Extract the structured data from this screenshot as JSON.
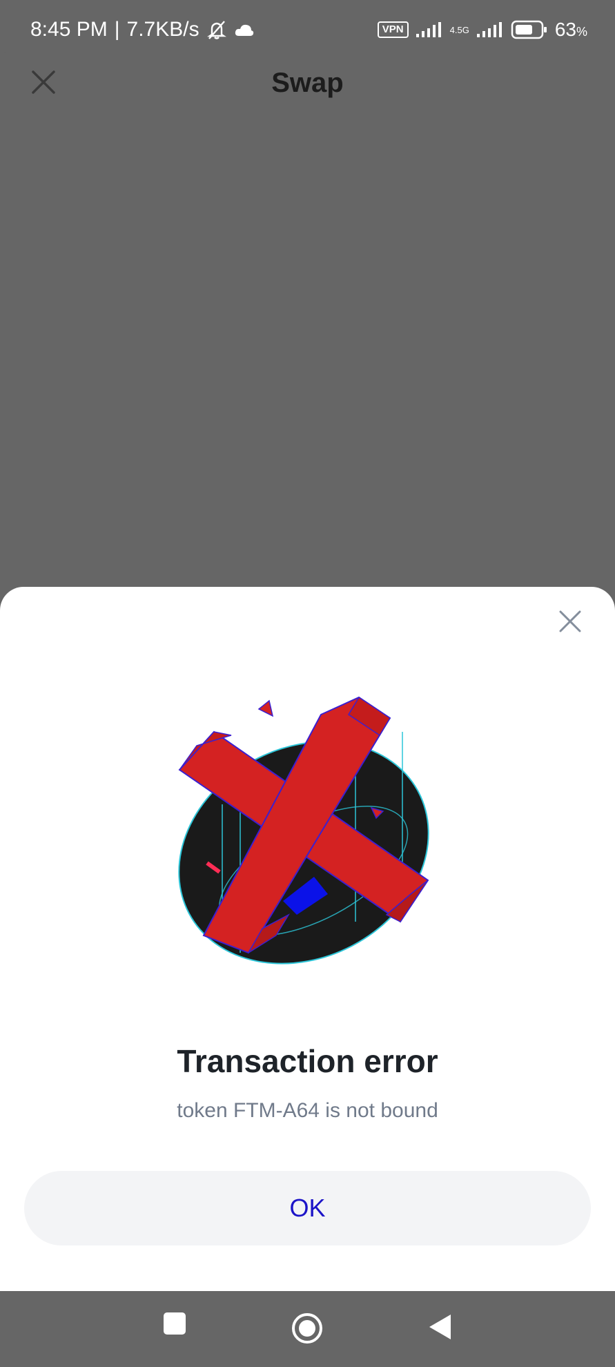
{
  "status_bar": {
    "time": "8:45 PM",
    "separator": "|",
    "network_speed": "7.7KB/s",
    "vpn_label": "VPN",
    "network_type": "4.5G",
    "battery_level": "63",
    "battery_unit": "%"
  },
  "app": {
    "title": "Swap"
  },
  "dialog": {
    "title": "Transaction error",
    "message": "token FTM-A64 is not bound",
    "ok_label": "OK"
  },
  "colors": {
    "overlay": "#666666",
    "accent": "#1c14c8",
    "error_red": "#d42222"
  }
}
